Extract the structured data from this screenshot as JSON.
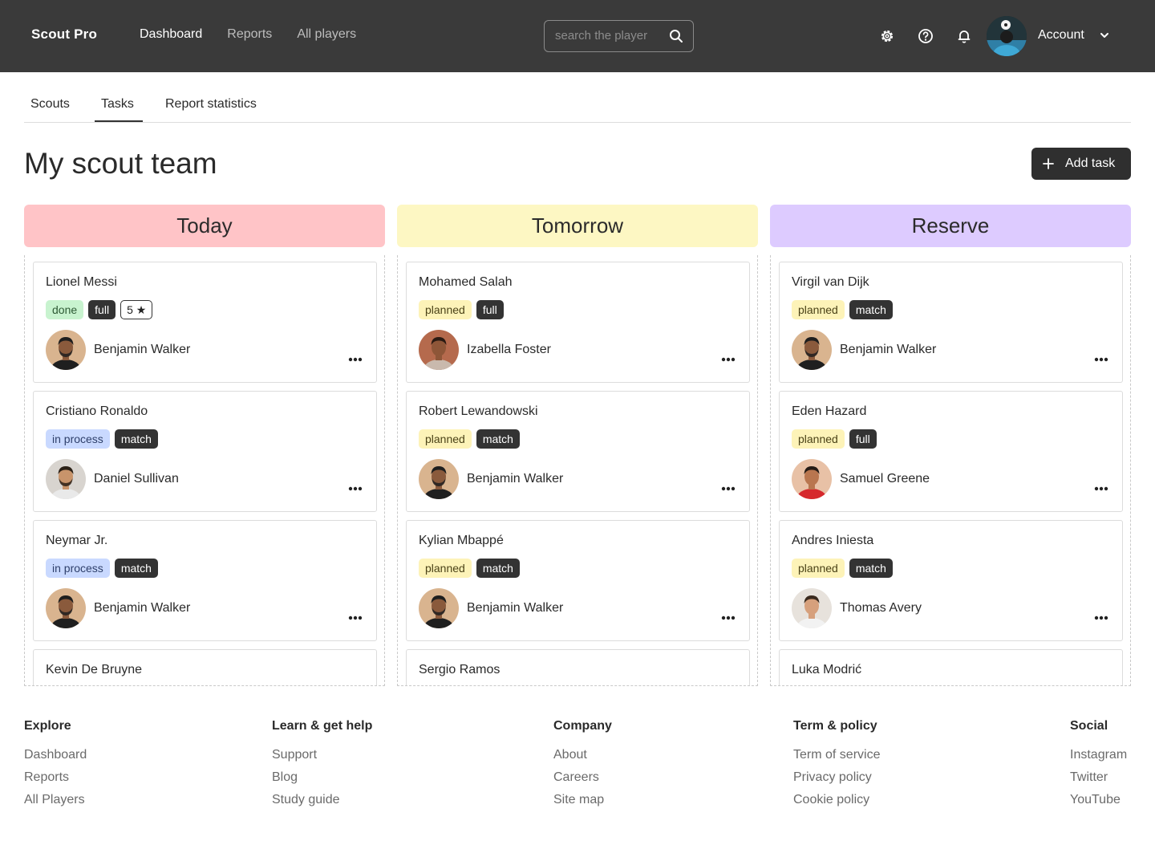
{
  "brand": "Scout Pro",
  "nav": [
    {
      "label": "Dashboard",
      "active": true
    },
    {
      "label": "Reports",
      "active": false
    },
    {
      "label": "All players",
      "active": false
    }
  ],
  "search": {
    "placeholder": "search the player"
  },
  "account": {
    "label": "Account"
  },
  "tabs": [
    {
      "label": "Scouts"
    },
    {
      "label": "Tasks",
      "active": true
    },
    {
      "label": "Report statistics"
    }
  ],
  "page_title": "My scout team",
  "add_task_label": "Add task",
  "columns": [
    {
      "title": "Today",
      "color": "#ffc4c7",
      "cards": [
        {
          "player": "Lionel Messi",
          "tags": [
            {
              "text": "done",
              "kind": "done"
            },
            {
              "text": "full",
              "kind": "dark"
            },
            {
              "text": "5 ★",
              "kind": "outline"
            }
          ],
          "scout": "Benjamin Walker",
          "avatar": "bw"
        },
        {
          "player": "Cristiano Ronaldo",
          "tags": [
            {
              "text": "in process",
              "kind": "inproc"
            },
            {
              "text": "match",
              "kind": "dark"
            }
          ],
          "scout": "Daniel Sullivan",
          "avatar": "ds"
        },
        {
          "player": "Neymar Jr.",
          "tags": [
            {
              "text": "in process",
              "kind": "inproc"
            },
            {
              "text": "match",
              "kind": "dark"
            }
          ],
          "scout": "Benjamin Walker",
          "avatar": "bw"
        },
        {
          "player": "Kevin De Bruyne",
          "tags": [],
          "scout": "",
          "avatar": ""
        }
      ]
    },
    {
      "title": "Tomorrow",
      "color": "#fdf7c3",
      "cards": [
        {
          "player": "Mohamed Salah",
          "tags": [
            {
              "text": "planned",
              "kind": "planned"
            },
            {
              "text": "full",
              "kind": "dark"
            }
          ],
          "scout": "Izabella Foster",
          "avatar": "if"
        },
        {
          "player": "Robert Lewandowski",
          "tags": [
            {
              "text": "planned",
              "kind": "planned"
            },
            {
              "text": "match",
              "kind": "dark"
            }
          ],
          "scout": "Benjamin Walker",
          "avatar": "bw"
        },
        {
          "player": "Kylian Mbappé",
          "tags": [
            {
              "text": "planned",
              "kind": "planned"
            },
            {
              "text": "match",
              "kind": "dark"
            }
          ],
          "scout": "Benjamin Walker",
          "avatar": "bw"
        },
        {
          "player": "Sergio Ramos",
          "tags": [],
          "scout": "",
          "avatar": ""
        }
      ]
    },
    {
      "title": "Reserve",
      "color": "#ddcbff",
      "cards": [
        {
          "player": "Virgil van Dijk",
          "tags": [
            {
              "text": "planned",
              "kind": "planned"
            },
            {
              "text": "match",
              "kind": "dark"
            }
          ],
          "scout": "Benjamin Walker",
          "avatar": "bw"
        },
        {
          "player": "Eden Hazard",
          "tags": [
            {
              "text": "planned",
              "kind": "planned"
            },
            {
              "text": "full",
              "kind": "dark"
            }
          ],
          "scout": "Samuel Greene",
          "avatar": "sg"
        },
        {
          "player": "Andres Iniesta",
          "tags": [
            {
              "text": "planned",
              "kind": "planned"
            },
            {
              "text": "match",
              "kind": "dark"
            }
          ],
          "scout": "Thomas Avery",
          "avatar": "ta"
        },
        {
          "player": "Luka Modrić",
          "tags": [],
          "scout": "",
          "avatar": ""
        }
      ]
    }
  ],
  "footer": [
    {
      "heading": "Explore",
      "links": [
        "Dashboard",
        "Reports",
        "All Players"
      ]
    },
    {
      "heading": "Learn & get help",
      "links": [
        "Support",
        "Blog",
        "Study guide"
      ]
    },
    {
      "heading": "Company",
      "links": [
        "About",
        "Careers",
        "Site map"
      ]
    },
    {
      "heading": "Term & policy",
      "links": [
        "Term of service",
        "Privacy policy",
        "Cookie policy"
      ]
    },
    {
      "heading": "Social",
      "links": [
        "Instagram",
        "Twitter",
        "YouTube"
      ]
    }
  ]
}
